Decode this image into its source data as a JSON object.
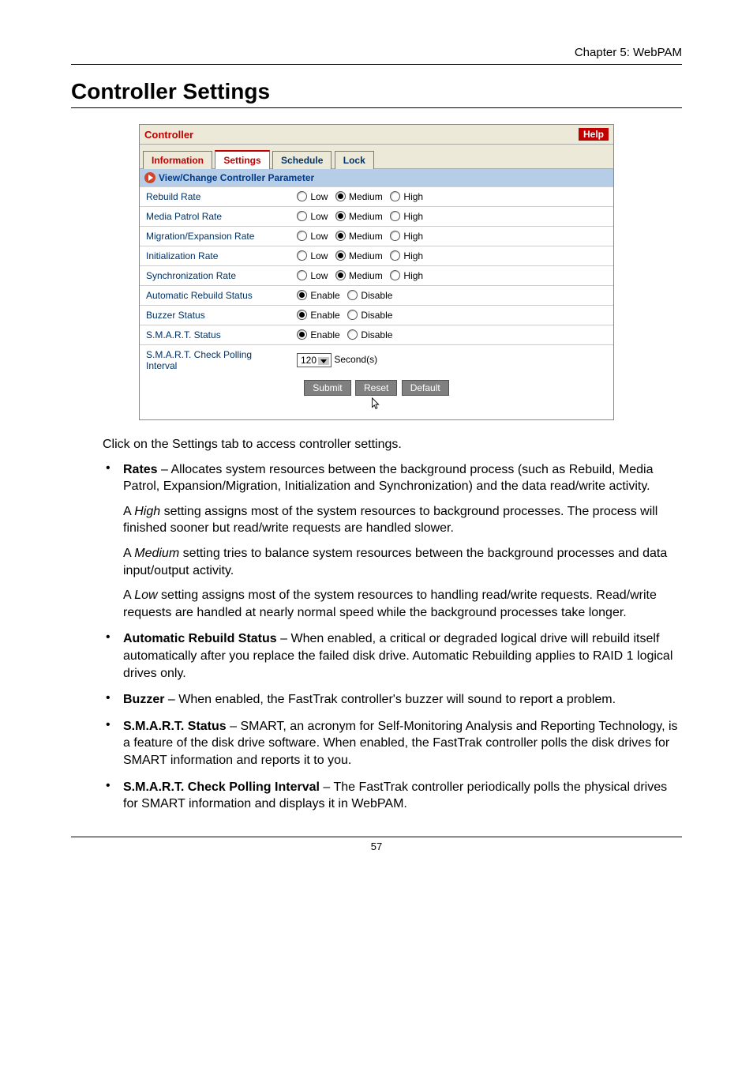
{
  "header": {
    "chapter": "Chapter 5: WebPAM"
  },
  "title": "Controller Settings",
  "panel": {
    "title": "Controller",
    "help": "Help",
    "tabs": {
      "information": "Information",
      "settings": "Settings",
      "schedule": "Schedule",
      "lock": "Lock"
    },
    "section": "View/Change Controller Parameter",
    "rows": {
      "rebuild_rate": {
        "label": "Rebuild Rate",
        "low": "Low",
        "medium": "Medium",
        "high": "High"
      },
      "media_patrol_rate": {
        "label": "Media Patrol Rate",
        "low": "Low",
        "medium": "Medium",
        "high": "High"
      },
      "migration_expansion_rate": {
        "label": "Migration/Expansion Rate",
        "low": "Low",
        "medium": "Medium",
        "high": "High"
      },
      "initialization_rate": {
        "label": "Initialization Rate",
        "low": "Low",
        "medium": "Medium",
        "high": "High"
      },
      "synchronization_rate": {
        "label": "Synchronization Rate",
        "low": "Low",
        "medium": "Medium",
        "high": "High"
      },
      "automatic_rebuild_status": {
        "label": "Automatic Rebuild Status",
        "enable": "Enable",
        "disable": "Disable"
      },
      "buzzer_status": {
        "label": "Buzzer Status",
        "enable": "Enable",
        "disable": "Disable"
      },
      "smart_status": {
        "label": "S.M.A.R.T. Status",
        "enable": "Enable",
        "disable": "Disable"
      },
      "smart_polling": {
        "label": "S.M.A.R.T. Check Polling Interval",
        "value": "120",
        "unit": "Second(s)"
      }
    },
    "buttons": {
      "submit": "Submit",
      "reset": "Reset",
      "default": "Default"
    }
  },
  "body": {
    "intro": "Click on the Settings tab to access controller settings.",
    "rates_label": "Rates",
    "rates_text": " – Allocates system resources between the background process (such as Rebuild, Media Patrol, Expansion/Migration, Initialization and Synchronization) and the data read/write activity.",
    "high_prefix": "A ",
    "high_word": "High",
    "high_text": " setting assigns most of the system resources to background processes. The process will finished sooner but read/write requests are handled slower.",
    "medium_prefix": "A ",
    "medium_word": "Medium",
    "medium_text": " setting tries to balance system resources between the background processes and data input/output activity.",
    "low_prefix": "A ",
    "low_word": "Low",
    "low_text": " setting assigns most of the system resources to handling read/write requests. Read/write requests are handled at nearly normal speed while the background processes take longer.",
    "auto_rebuild_label": "Automatic Rebuild Status",
    "auto_rebuild_text": " – When enabled, a critical or degraded logical drive will rebuild itself automatically after you replace the failed disk drive. Automatic Rebuilding applies to RAID 1 logical drives only.",
    "buzzer_label": "Buzzer",
    "buzzer_text": " – When enabled, the FastTrak controller's buzzer will sound to report a problem.",
    "smart_status_label": "S.M.A.R.T. Status",
    "smart_status_text": " – SMART, an acronym for Self-Monitoring Analysis and Reporting Technology, is a feature of the disk drive software. When enabled, the FastTrak controller polls the disk drives for SMART information and reports it to you.",
    "smart_poll_label": "S.M.A.R.T. Check Polling Interval",
    "smart_poll_text": " – The FastTrak controller periodically polls the physical drives for SMART information and displays it in WebPAM."
  },
  "footer": {
    "page_number": "57"
  }
}
